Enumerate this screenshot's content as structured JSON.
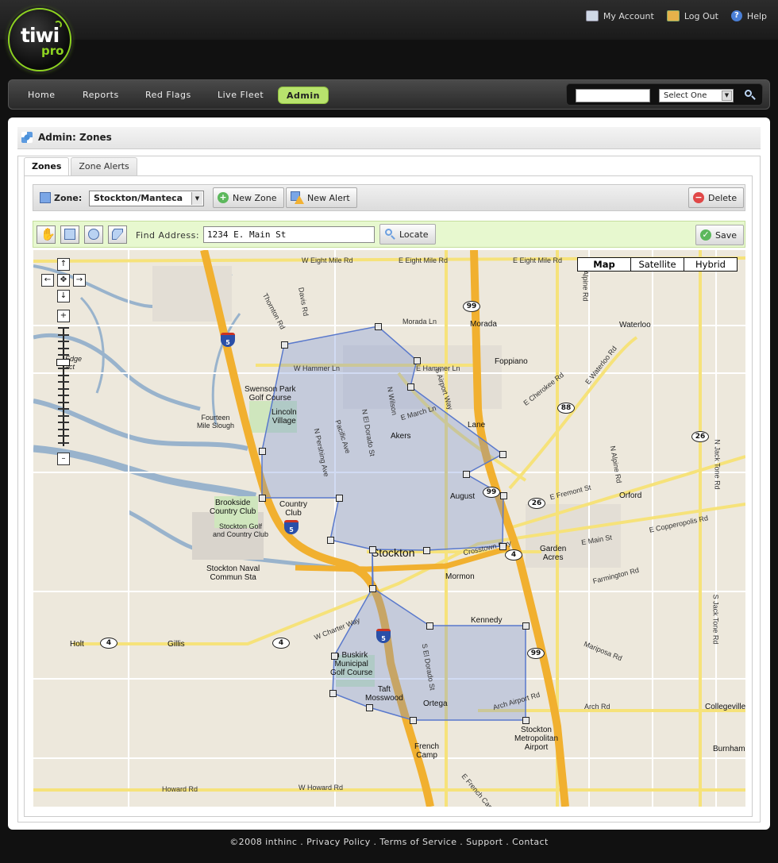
{
  "header": {
    "logo_text": "tiwi",
    "logo_sub": "pro",
    "links": [
      {
        "label": "My Account",
        "icon": "account-card-icon"
      },
      {
        "label": "Log Out",
        "icon": "logout-door-icon"
      },
      {
        "label": "Help",
        "icon": "help-circle-icon"
      }
    ]
  },
  "nav": {
    "items": [
      "Home",
      "Reports",
      "Red Flags",
      "Live Fleet",
      "Admin"
    ],
    "active": "Admin",
    "search_placeholder": "",
    "search_select": "Select One"
  },
  "panel": {
    "title": "Admin: Zones",
    "tabs": [
      "Zones",
      "Zone Alerts"
    ],
    "active_tab": "Zones"
  },
  "zonebar": {
    "zone_label": "Zone:",
    "zone_value": "Stockton/Manteca",
    "new_zone": "New Zone",
    "new_alert": "New Alert",
    "delete": "Delete"
  },
  "toolbar": {
    "find_label": "Find Address:",
    "address_value": "1234 E. Main St",
    "locate": "Locate",
    "save": "Save"
  },
  "map": {
    "types": [
      "Map",
      "Satellite",
      "Hybrid"
    ],
    "active_type": "Map",
    "pan": {
      "up": "↑",
      "left": "←",
      "center": "✥",
      "right": "→",
      "down": "↓"
    },
    "zoom_in": "+",
    "zoom_out": "–",
    "zone_color": "#6f8fd9",
    "labels": {
      "w_eight_mile": "W Eight Mile Rd",
      "e_eight_mile": "E Eight Mile Rd",
      "e_eight_mile_2": "E Eight Mile Rd",
      "thornton": "Thornton Rd",
      "davis": "Davis Rd",
      "alpine": "Alpine Rd",
      "morada_ln": "Morada Ln",
      "morada": "Morada",
      "waterloo": "Waterloo",
      "w_hammer": "W Hammer Ln",
      "e_hammer": "E Hammer Ln",
      "foppiano": "Foppiano",
      "swenson": "Swenson Park\nGolf Course",
      "lincoln": "Lincoln\nVillage",
      "fourteen": "Fourteen\nMile Slough",
      "akers": "Akers",
      "lane": "Lane",
      "e_cherokee": "E Cherokee Rd",
      "e_waterloo": "E Waterloo Rd",
      "brookside": "Brookside\nCountry Club",
      "country_club": "Country\nClub",
      "stockton_golf": "Stockton Golf\nand Country Club",
      "august": "August",
      "e_fremont": "E Fremont St",
      "n_alpine": "N Alpine Rd",
      "orford": "Orford",
      "stockton": "Stockton",
      "crosstown": "Crosstown Fwy",
      "garden_acres": "Garden\nAcres",
      "e_main": "E Main St",
      "e_copperopolis": "E Copperopolis Rd",
      "naval": "Stockton Naval\nCommun Sta",
      "mormon": "Mormon",
      "farmington": "Farmington Rd",
      "kennedy": "Kennedy",
      "holt": "Holt",
      "gillis": "Gillis",
      "w_charter": "W Charter Way",
      "buskirk": "n Buskirk\nMunicipal\nGolf Course",
      "mariposa": "Mariposa Rd",
      "taft": "Taft\nMosswood",
      "ortega": "Ortega",
      "arch_airport": "Arch Airport Rd",
      "arch_rd": "Arch Rd",
      "collegeville": "Collegeville",
      "airport": "Stockton\nMetropolitan\nAirport",
      "french_camp": "French\nCamp",
      "burnham": "Burnham",
      "howard": "Howard Rd",
      "w_howard": "W Howard Rd",
      "french_camp_rd": "E French Camp",
      "s_jack_tone": "S Jack Tone Rd",
      "n_jack_tone": "N Jack Tone Rd",
      "n_pershing": "N Pershing Ave",
      "pacific": "Pacific Ave",
      "el_dorado": "N El Dorado St",
      "s_el_dorado": "S El Dorado St",
      "n_wilson": "N Wilson",
      "e_march": "E March Ln",
      "s_airport": "S Airport Way",
      "edge": "Edge\nact"
    },
    "shields": [
      "5",
      "5",
      "5",
      "99",
      "99",
      "99",
      "4",
      "4",
      "4",
      "88",
      "26",
      "26"
    ]
  },
  "footer": {
    "copyright": "©2008 inthinc",
    "links": [
      "Privacy Policy",
      "Terms of Service",
      "Support",
      "Contact"
    ]
  }
}
